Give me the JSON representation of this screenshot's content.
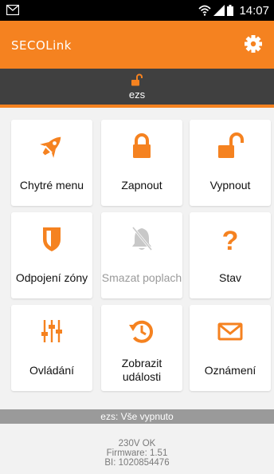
{
  "status_bar": {
    "time": "14:07",
    "icons": [
      "mail-icon",
      "wifi-icon",
      "signal-icon",
      "battery-icon"
    ]
  },
  "app_bar": {
    "logo_text": "SECOLink",
    "settings_icon": "gear-icon",
    "background_color": "#f58220"
  },
  "section": {
    "icon": "lock-open-icon",
    "title": "ezs",
    "background_color": "#404040",
    "accent_color": "#f58220"
  },
  "tiles": [
    {
      "icon": "rocket-icon",
      "label": "Chytré menu",
      "enabled": true
    },
    {
      "icon": "lock-closed-icon",
      "label": "Zapnout",
      "enabled": true
    },
    {
      "icon": "lock-open-icon",
      "label": "Vypnout",
      "enabled": true
    },
    {
      "icon": "shield-icon",
      "label": "Odpojení zóny",
      "enabled": true
    },
    {
      "icon": "bell-off-icon",
      "label": "Smazat poplach",
      "enabled": false
    },
    {
      "icon": "question-icon",
      "label": "Stav",
      "enabled": true
    },
    {
      "icon": "sliders-icon",
      "label": "Ovládání",
      "enabled": true
    },
    {
      "icon": "history-icon",
      "label": "Zobrazit události",
      "enabled": true
    },
    {
      "icon": "envelope-icon",
      "label": "Oznámení",
      "enabled": true
    }
  ],
  "status_message": "ezs: Vše vypnuto",
  "footer": {
    "power": "230V OK",
    "firmware": "Firmware: 1.51",
    "bi": "BI: 1020854476"
  }
}
